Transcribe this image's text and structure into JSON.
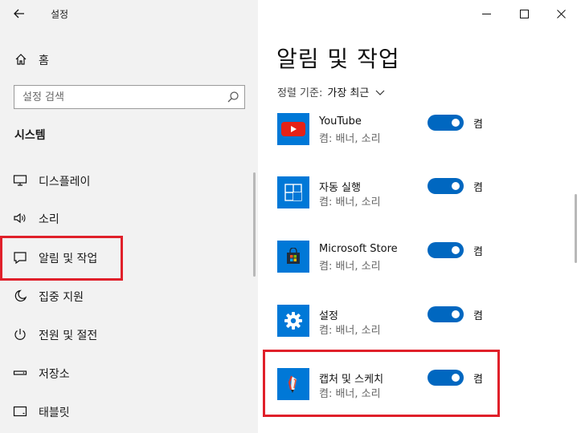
{
  "window": {
    "title": "설정"
  },
  "sidebar": {
    "home_label": "홈",
    "search_placeholder": "설정 검색",
    "section_title": "시스템",
    "items": [
      {
        "label": "디스플레이",
        "icon": "monitor-icon"
      },
      {
        "label": "소리",
        "icon": "speaker-icon"
      },
      {
        "label": "알림 및 작업",
        "icon": "notification-icon",
        "highlighted": true
      },
      {
        "label": "집중 지원",
        "icon": "moon-icon"
      },
      {
        "label": "전원 및 절전",
        "icon": "power-icon"
      },
      {
        "label": "저장소",
        "icon": "storage-icon"
      },
      {
        "label": "태블릿",
        "icon": "tablet-icon"
      }
    ]
  },
  "main": {
    "title": "알림 및 작업",
    "sort_label": "정렬 기준:",
    "sort_value": "가장 최근",
    "apps": [
      {
        "name": "YouTube",
        "sub": "켬: 배너, 소리",
        "state": "켬",
        "icon": "youtube-icon"
      },
      {
        "name": "자동 실행",
        "sub": "켬: 배너, 소리",
        "state": "켬",
        "icon": "autoplay-icon"
      },
      {
        "name": "Microsoft Store",
        "sub": "켬: 배너, 소리",
        "state": "켬",
        "icon": "store-icon"
      },
      {
        "name": "설정",
        "sub": "켬: 배너, 소리",
        "state": "켬",
        "icon": "settings-gear-icon"
      },
      {
        "name": "캡처 및 스케치",
        "sub": "켬: 배너, 소리",
        "state": "켬",
        "icon": "snip-sketch-icon",
        "highlighted": true
      }
    ]
  },
  "colors": {
    "accent": "#0067c0",
    "tile_blue": "#0078d7",
    "highlight_red": "#e0202a",
    "sidebar_bg": "#f2f2f2"
  }
}
